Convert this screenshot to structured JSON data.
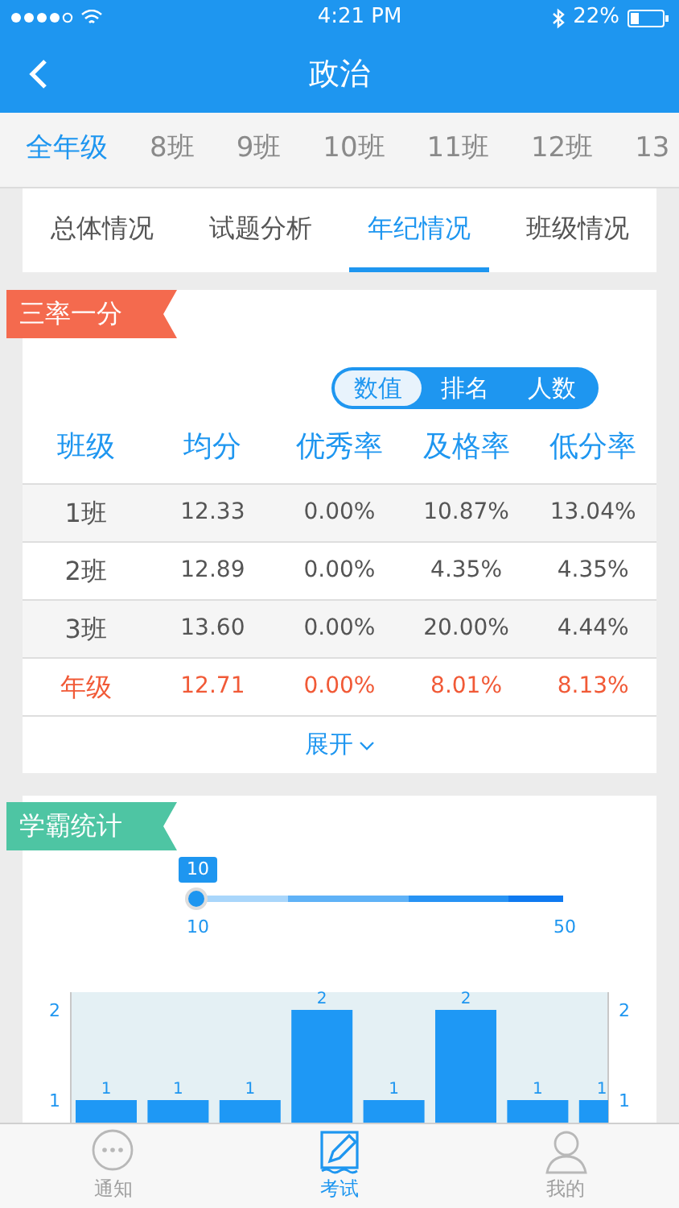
{
  "status_bar": {
    "time": "4:21 PM",
    "battery": "22%"
  },
  "nav": {
    "title": "政治"
  },
  "class_tabs": [
    {
      "label": "全年级",
      "selected": true
    },
    {
      "label": "8班",
      "selected": false
    },
    {
      "label": "9班",
      "selected": false
    },
    {
      "label": "10班",
      "selected": false
    },
    {
      "label": "11班",
      "selected": false
    },
    {
      "label": "12班",
      "selected": false
    },
    {
      "label": "13",
      "selected": false
    }
  ],
  "sub_tabs": [
    {
      "label": "总体情况",
      "selected": false
    },
    {
      "label": "试题分析",
      "selected": false
    },
    {
      "label": "年纪情况",
      "selected": true
    },
    {
      "label": "班级情况",
      "selected": false
    }
  ],
  "rates_card": {
    "tag": "三率一分",
    "toggle": [
      {
        "label": "数值",
        "selected": true
      },
      {
        "label": "排名",
        "selected": false
      },
      {
        "label": "人数",
        "selected": false
      }
    ],
    "columns": [
      "班级",
      "均分",
      "优秀率",
      "及格率",
      "低分率"
    ],
    "rows": [
      {
        "cells": [
          "1班",
          "12.33",
          "0.00%",
          "10.87%",
          "13.04%"
        ],
        "highlight": false
      },
      {
        "cells": [
          "2班",
          "12.89",
          "0.00%",
          "4.35%",
          "4.35%"
        ],
        "highlight": false
      },
      {
        "cells": [
          "3班",
          "13.60",
          "0.00%",
          "20.00%",
          "4.44%"
        ],
        "highlight": false
      },
      {
        "cells": [
          "年级",
          "12.71",
          "0.00%",
          "8.01%",
          "8.13%"
        ],
        "highlight": true
      }
    ],
    "expand": "展开"
  },
  "top_card": {
    "tag": "学霸统计",
    "slider": {
      "bubble": "10",
      "min": "10",
      "max": "50",
      "level": 0
    },
    "bar_chart": {
      "left_axis_labels": [
        "2",
        "1"
      ],
      "right_axis_labels": [
        "2",
        "1"
      ],
      "bar_labels": [
        "1",
        "1",
        "1",
        "2",
        "1",
        "2",
        "1",
        "1"
      ]
    }
  },
  "tab_bar": [
    {
      "label": "通知",
      "selected": false
    },
    {
      "label": "考试",
      "selected": true
    },
    {
      "label": "我的",
      "selected": false
    }
  ]
}
